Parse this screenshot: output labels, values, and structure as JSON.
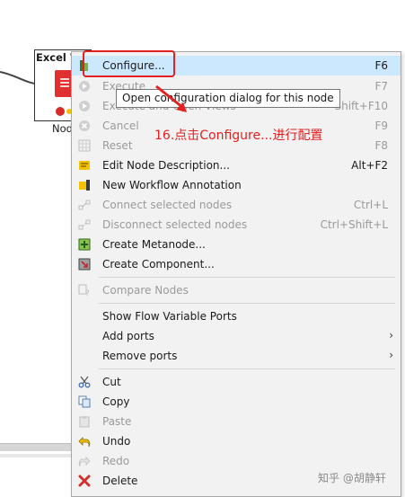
{
  "canvas": {
    "node": {
      "title": "Excel W",
      "label": "Nod"
    }
  },
  "menu": {
    "items": [
      {
        "name": "configure",
        "icon": "configure-icon",
        "label": "Configure...",
        "shortcut": "F6",
        "enabled": true,
        "highlighted": true
      },
      {
        "name": "execute",
        "icon": "execute-icon",
        "label": "Execute",
        "shortcut": "F7",
        "enabled": false
      },
      {
        "name": "execute-and-open-views",
        "icon": "execute-open-views-icon",
        "label": "Execute and Open Views",
        "shortcut": "Shift+F10",
        "enabled": false
      },
      {
        "name": "cancel",
        "icon": "cancel-icon",
        "label": "Cancel",
        "shortcut": "F9",
        "enabled": false
      },
      {
        "name": "reset",
        "icon": "reset-icon",
        "label": "Reset",
        "shortcut": "F8",
        "enabled": false
      },
      {
        "name": "edit-node-description",
        "icon": "edit-description-icon",
        "label": "Edit Node Description...",
        "shortcut": "Alt+F2",
        "enabled": true
      },
      {
        "name": "new-workflow-annotation",
        "icon": "annotation-icon",
        "label": "New Workflow Annotation",
        "shortcut": "",
        "enabled": true
      },
      {
        "name": "connect-selected-nodes",
        "icon": "connect-icon",
        "label": "Connect selected nodes",
        "shortcut": "Ctrl+L",
        "enabled": false
      },
      {
        "name": "disconnect-selected-nodes",
        "icon": "disconnect-icon",
        "label": "Disconnect selected nodes",
        "shortcut": "Ctrl+Shift+L",
        "enabled": false
      },
      {
        "name": "create-metanode",
        "icon": "metanode-icon",
        "label": "Create Metanode...",
        "shortcut": "",
        "enabled": true
      },
      {
        "name": "create-component",
        "icon": "component-icon",
        "label": "Create Component...",
        "shortcut": "",
        "enabled": true
      },
      {
        "name": "compare-nodes",
        "icon": "compare-icon",
        "label": "Compare Nodes",
        "shortcut": "",
        "enabled": false
      },
      {
        "name": "show-flow-variable-ports",
        "icon": "",
        "label": "Show Flow Variable Ports",
        "shortcut": "",
        "enabled": true
      },
      {
        "name": "add-ports",
        "icon": "",
        "label": "Add ports",
        "shortcut": "",
        "enabled": true,
        "submenu": true
      },
      {
        "name": "remove-ports",
        "icon": "",
        "label": "Remove ports",
        "shortcut": "",
        "enabled": true,
        "submenu": true
      },
      {
        "name": "cut",
        "icon": "scissors-icon",
        "label": "Cut",
        "shortcut": "",
        "enabled": true
      },
      {
        "name": "copy",
        "icon": "copy-icon",
        "label": "Copy",
        "shortcut": "",
        "enabled": true
      },
      {
        "name": "paste",
        "icon": "paste-icon",
        "label": "Paste",
        "shortcut": "",
        "enabled": false
      },
      {
        "name": "undo",
        "icon": "undo-icon",
        "label": "Undo",
        "shortcut": "",
        "enabled": true
      },
      {
        "name": "redo",
        "icon": "redo-icon",
        "label": "Redo",
        "shortcut": "",
        "enabled": false
      },
      {
        "name": "delete",
        "icon": "delete-icon",
        "label": "Delete",
        "shortcut": "",
        "enabled": true
      }
    ],
    "submenu_arrow": "›"
  },
  "tooltip": "Open configuration dialog for this node",
  "annotation": "16.点击Configure...进行配置",
  "watermark": "知乎 @胡静轩",
  "colors": {
    "accent_red": "#e52020",
    "highlight": "#cce8ff"
  }
}
